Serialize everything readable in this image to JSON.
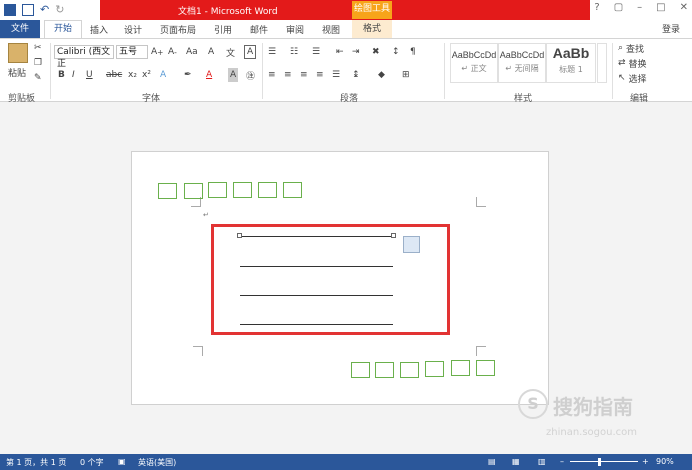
{
  "title": {
    "text": "文档1 - Microsoft Word",
    "contextual_group": "绘图工具",
    "controls": [
      "?",
      "▢",
      "–",
      "□",
      "✕"
    ]
  },
  "tabs": {
    "file": "文件",
    "active": "开始",
    "items": [
      "插入",
      "设计",
      "页面布局",
      "引用",
      "邮件",
      "审阅",
      "视图"
    ],
    "contextual": "格式",
    "login": "登录"
  },
  "ribbon": {
    "clipboard": {
      "paste": "粘贴",
      "label": "剪贴板"
    },
    "font": {
      "family": "Calibri (西文正",
      "size": "五号",
      "label": "字体",
      "buttons": [
        "B",
        "I",
        "U",
        "abc",
        "x₂",
        "x²"
      ]
    },
    "paragraph": {
      "label": "段落"
    },
    "styles": {
      "label": "样式",
      "cards": [
        {
          "sample": "AaBbCcDd",
          "name": "↵ 正文"
        },
        {
          "sample": "AaBbCcDd",
          "name": "↵ 无间隔"
        },
        {
          "sample": "AaBb",
          "name": "标题 1"
        }
      ]
    },
    "editing": {
      "label": "编辑",
      "find": "查找",
      "replace": "替换",
      "select": "选择"
    }
  },
  "statusbar": {
    "page": "第 1 页，共 1 页",
    "words": "0 个字",
    "language": "英语(美国)",
    "zoom": "90%"
  },
  "watermark": {
    "logo": "S",
    "text": "搜狗指南",
    "url": "zhinan.sogou.com"
  }
}
